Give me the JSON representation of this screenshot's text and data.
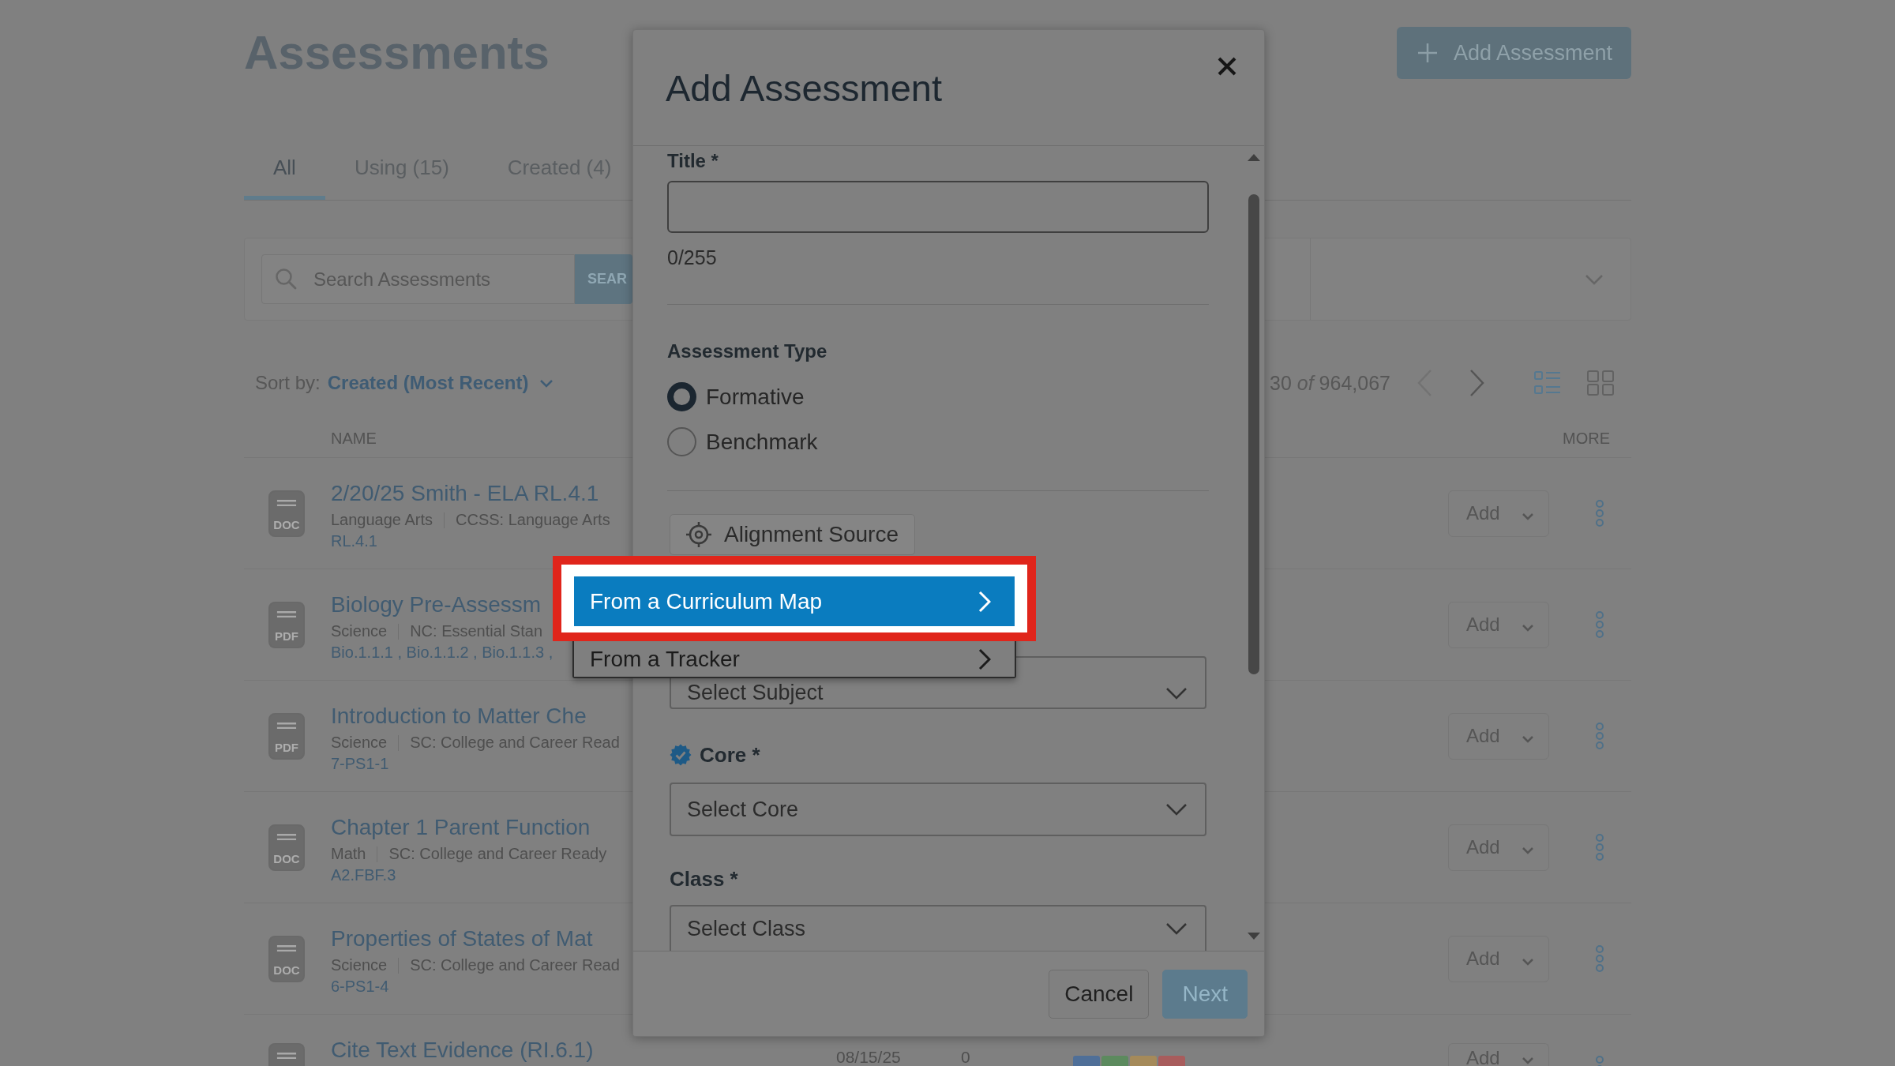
{
  "page": {
    "title": "Assessments",
    "add_button": "Add Assessment"
  },
  "tabs": [
    {
      "label": "All",
      "selected": true
    },
    {
      "label": "Using (15)",
      "selected": false
    },
    {
      "label": "Created (4)",
      "selected": false
    }
  ],
  "search": {
    "placeholder": "Search Assessments",
    "button": "SEAR"
  },
  "sort": {
    "label": "Sort by:",
    "value": "Created (Most Recent)"
  },
  "pager": {
    "range": "30 *of* 964,067",
    "prev": {
      "disabled": true
    },
    "next": {
      "disabled": false
    }
  },
  "views": [
    {
      "kind": "list",
      "selected": true
    },
    {
      "kind": "grid",
      "selected": false
    }
  ],
  "columns": {
    "name": "NAME",
    "more": "MORE"
  },
  "rows": [
    {
      "file_type": "DOC",
      "title": "2/20/25 Smith - ELA RL.4.1",
      "subject": "Language Arts",
      "standard_set": "CCSS: Language Arts",
      "standards": "RL.4.1",
      "action": "Add"
    },
    {
      "file_type": "PDF",
      "title": "Biology Pre-Assessm",
      "subject": "Science",
      "standard_set": "NC: Essential Stan",
      "standards": "Bio.1.1.1 , Bio.1.1.2 , Bio.1.1.3 ,",
      "action": "Add"
    },
    {
      "file_type": "PDF",
      "title": "Introduction to Matter Che",
      "subject": "Science",
      "standard_set": "SC: College and Career Read",
      "standards": "7-PS1-1",
      "action": "Add"
    },
    {
      "file_type": "DOC",
      "title": "Chapter 1 Parent Function",
      "subject": "Math",
      "standard_set": "SC: College and Career Ready",
      "standards": "A2.FBF.3",
      "action": "Add"
    },
    {
      "file_type": "DOC",
      "title": "Properties of States of Mat",
      "subject": "Science",
      "standard_set": "SC: College and Career Read",
      "standards": "6-PS1-4",
      "action": "Add"
    },
    {
      "title": "Cite Text Evidence (RI.6.1)",
      "date": "08/15/25",
      "count": "0",
      "tags": [
        {
          "color": "#4f6f98"
        },
        {
          "color": "#5c8a5e"
        },
        {
          "color": "#a58a5a"
        },
        {
          "color": "#a85c5c"
        }
      ],
      "action": "Add"
    }
  ],
  "dialog": {
    "title": "Add Assessment",
    "title_field": {
      "label": "Title *",
      "counter": "0/255"
    },
    "type_field": {
      "label": "Assessment Type",
      "options": [
        {
          "label": "Formative",
          "selected": true
        },
        {
          "label": "Benchmark",
          "selected": false
        }
      ]
    },
    "alignment_button": "Alignment Source",
    "alignment_menu": [
      {
        "label": "From a Curriculum Map",
        "selected": true,
        "highlighted": true
      },
      {
        "label": "From a Tracker",
        "selected": false,
        "highlighted": false
      }
    ],
    "subject_field": {
      "placeholder": "Select Subject"
    },
    "core_field": {
      "label": "Core *",
      "verified": true,
      "placeholder": "Select Core"
    },
    "class_field": {
      "label": "Class *",
      "placeholder": "Select Class"
    },
    "buttons": [
      {
        "label": "Cancel",
        "kind": "secondary"
      },
      {
        "label": "Next",
        "kind": "primary"
      }
    ]
  }
}
